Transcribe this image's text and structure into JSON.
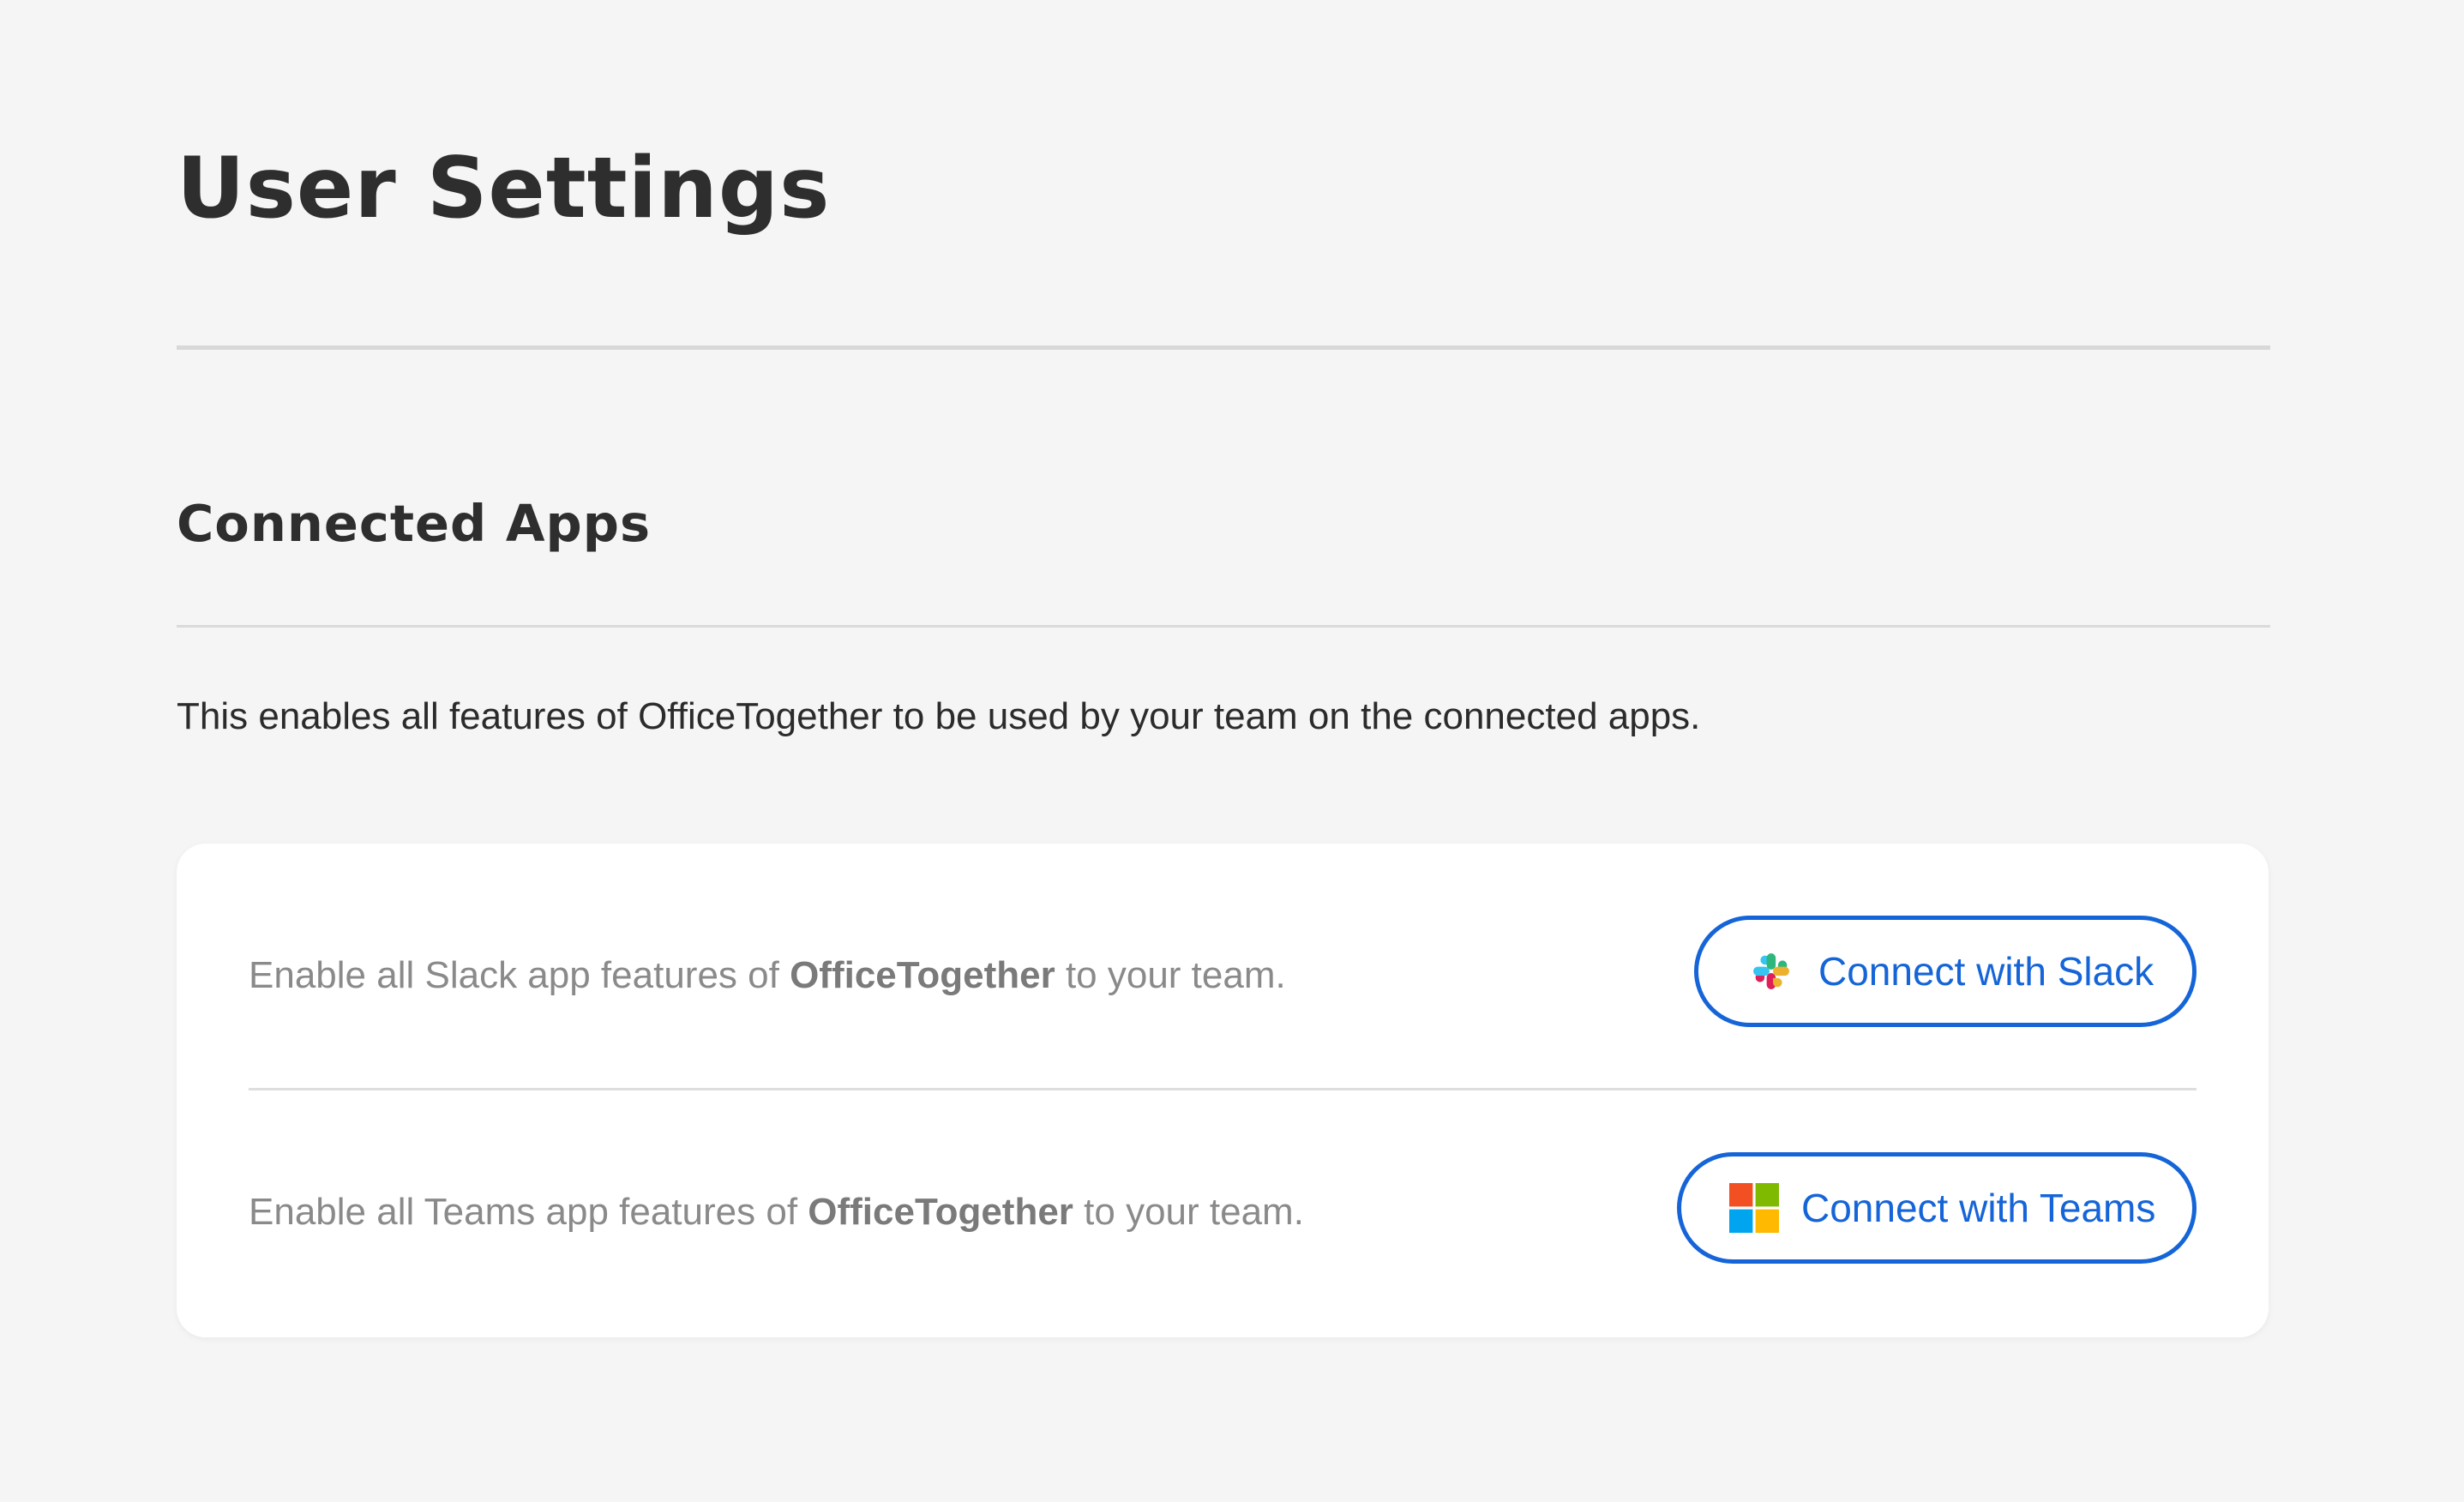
{
  "page": {
    "title": "User Settings"
  },
  "connected_apps": {
    "title": "Connected Apps",
    "description": "This enables all features of OfficeTogether to be used by your team on the connected apps.",
    "items": [
      {
        "text_before": "Enable all Slack app features of ",
        "brand": "OfficeTogether",
        "text_after": " to your team.",
        "button_label": "Connect with Slack",
        "icon": "slack-logo-icon"
      },
      {
        "text_before": "Enable all Teams app features of ",
        "brand": "OfficeTogether",
        "text_after": " to your team.",
        "button_label": "Connect with Teams",
        "icon": "microsoft-logo-icon"
      }
    ]
  },
  "colors": {
    "accent": "#1565d8",
    "background": "#f5f5f5",
    "card": "#ffffff",
    "muted_text": "#8a8a8a",
    "slack_blue": "#36c5f0",
    "slack_green": "#2eb67d",
    "slack_yellow": "#ecb22e",
    "slack_red": "#e01e5a",
    "ms_red": "#f25022",
    "ms_green": "#7fba00",
    "ms_blue": "#00a4ef",
    "ms_yellow": "#ffb900"
  }
}
